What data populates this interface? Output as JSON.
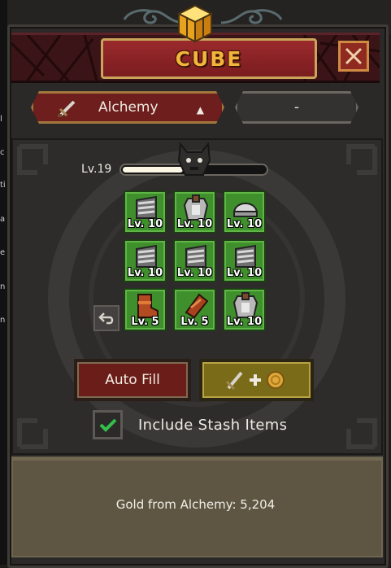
{
  "left_strip": {
    "chars": [
      "l",
      "c",
      "ti",
      "a",
      "e",
      "n",
      "n"
    ]
  },
  "header": {
    "title": "CUBE"
  },
  "tabs": [
    {
      "label": "Alchemy",
      "icon": "sword-icon",
      "active": true
    },
    {
      "label": "-",
      "active": false
    }
  ],
  "level": {
    "label": "Lv.19",
    "progress": 0.42
  },
  "slots": [
    {
      "item": "chain-armor",
      "level": "Lv. 10"
    },
    {
      "item": "plate-armor",
      "level": "Lv. 10"
    },
    {
      "item": "helmet",
      "level": "Lv. 10"
    },
    {
      "item": "chain-armor",
      "level": "Lv. 10"
    },
    {
      "item": "chain-armor",
      "level": "Lv. 10"
    },
    {
      "item": "chain-armor",
      "level": "Lv. 10"
    },
    {
      "item": "leather-boots",
      "level": "Lv. 5"
    },
    {
      "item": "leather-bracer",
      "level": "Lv. 5"
    },
    {
      "item": "plate-armor",
      "level": "Lv. 10"
    }
  ],
  "buttons": {
    "auto_fill": "Auto Fill",
    "craft_icons": [
      "sword-icon",
      "plus-icon",
      "gold-coin-icon"
    ]
  },
  "stash": {
    "label": "Include Stash Items",
    "checked": true
  },
  "footer": {
    "gold_label": "Gold from Alchemy: 5,204"
  },
  "colors": {
    "slot_green": "#3f8f2c",
    "title_gold": "#f3b43c",
    "banner_red": "#7a1c1f",
    "check_green": "#33c04a"
  }
}
